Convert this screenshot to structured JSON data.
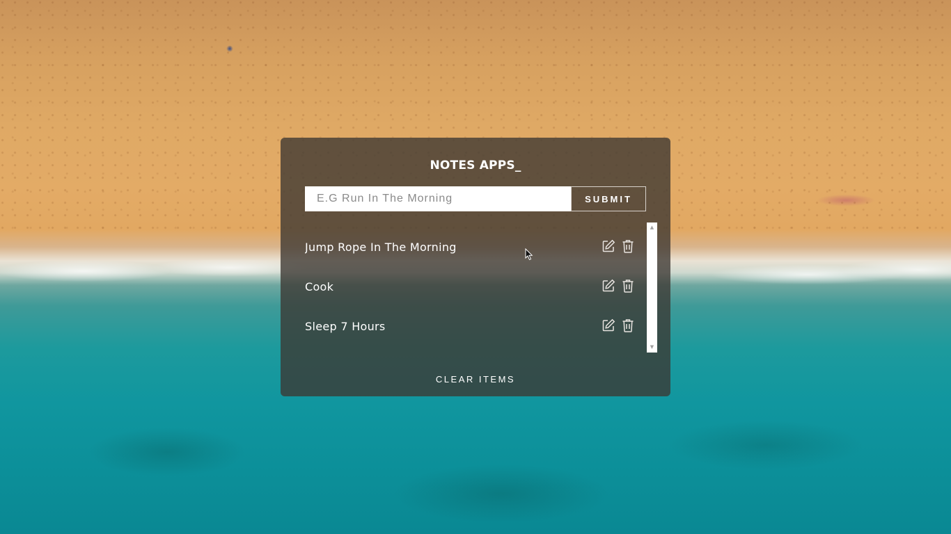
{
  "app": {
    "title": "NOTES APPS_"
  },
  "form": {
    "placeholder": "E.G Run In The Morning",
    "value": "",
    "submit_label": "SUBMIT"
  },
  "notes": [
    {
      "text": "Jump Rope In The Morning",
      "edit_icon": "edit-icon",
      "delete_icon": "trash-icon"
    },
    {
      "text": "Cook",
      "edit_icon": "edit-icon",
      "delete_icon": "trash-icon"
    },
    {
      "text": "Sleep 7 Hours",
      "edit_icon": "edit-icon",
      "delete_icon": "trash-icon"
    }
  ],
  "scrollbar": {
    "up_icon": "arrow-up-icon",
    "down_icon": "arrow-down-icon"
  },
  "footer": {
    "clear_label": "CLEAR ITEMS"
  },
  "colors": {
    "panel_bg": "#3c3732",
    "text": "#ffffff",
    "input_bg": "#ffffff"
  }
}
